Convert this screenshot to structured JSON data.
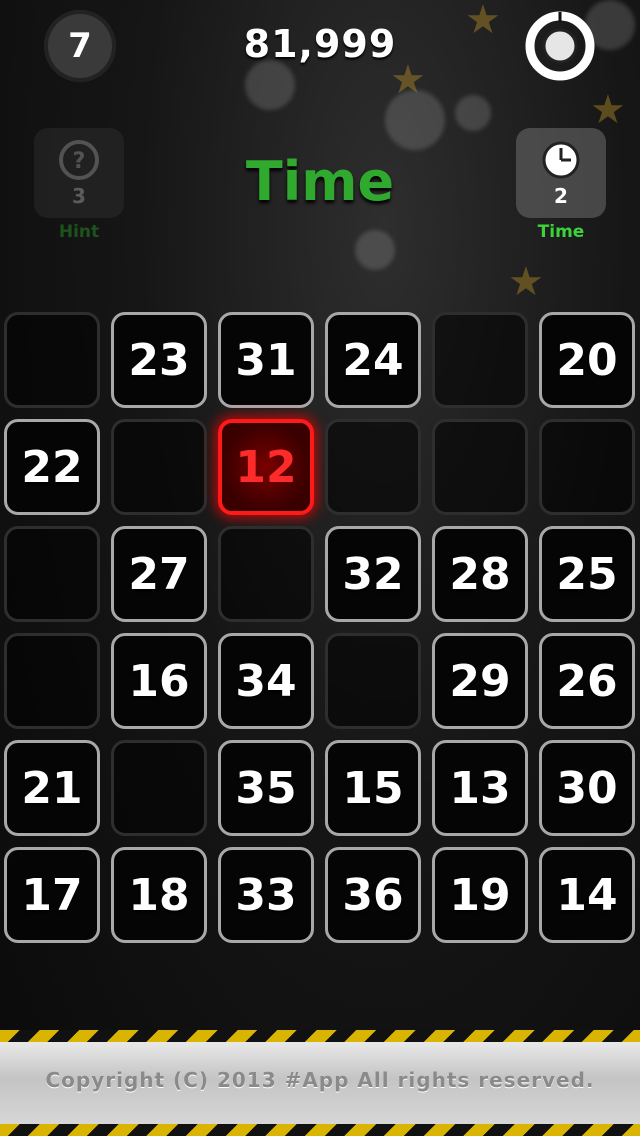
{
  "header": {
    "level": "7",
    "score": "81,999"
  },
  "mode_title": "Time",
  "powerups": {
    "hint": {
      "count": "3",
      "label": "Hint"
    },
    "time": {
      "count": "2",
      "label": "Time"
    }
  },
  "colors": {
    "accent_green": "#2faa2f",
    "active_red": "#ff1a1a",
    "tile_border": "#a8a8a8"
  },
  "grid": {
    "rows": [
      [
        "",
        "23",
        "31",
        "24",
        "",
        "20"
      ],
      [
        "22",
        "",
        "12",
        "",
        "",
        ""
      ],
      [
        "",
        "27",
        "",
        "32",
        "28",
        "25"
      ],
      [
        "",
        "16",
        "34",
        "",
        "29",
        "26"
      ],
      [
        "21",
        "",
        "35",
        "15",
        "13",
        "30"
      ],
      [
        "17",
        "18",
        "33",
        "36",
        "19",
        "14"
      ]
    ],
    "active": "12"
  },
  "footer": {
    "copyright": "Copyright (C) 2013 #App All rights reserved."
  }
}
